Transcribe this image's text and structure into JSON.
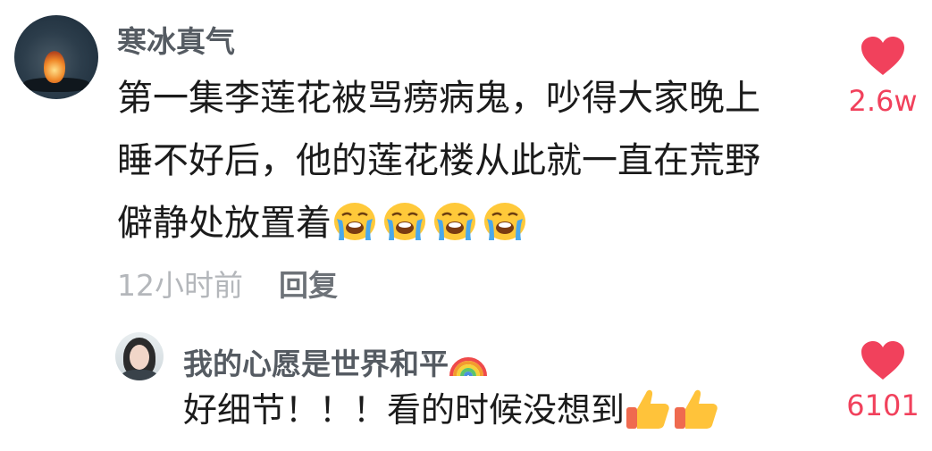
{
  "comments": [
    {
      "username": "寒冰真气",
      "text_lines": [
        "第一集李莲花被骂痨病鬼，吵得大家晚上",
        "睡不好后，他的莲花楼从此就一直在荒野",
        "僻静处放置着"
      ],
      "emoji": "loudly-crying-face-icon ×4",
      "time": "12小时前",
      "reply_label": "回复",
      "likes": "2.6w"
    },
    {
      "username": "我的心愿是世界和平",
      "username_emoji": "rainbow-icon",
      "text": "好细节！！！看的时候没想到",
      "emoji": "thumbs-up-icon ×2",
      "likes": "6101"
    }
  ],
  "colors": {
    "like_accent": "#f1415c",
    "username": "#555b62",
    "text": "#1b1b1b",
    "time": "#b4b7bb"
  }
}
